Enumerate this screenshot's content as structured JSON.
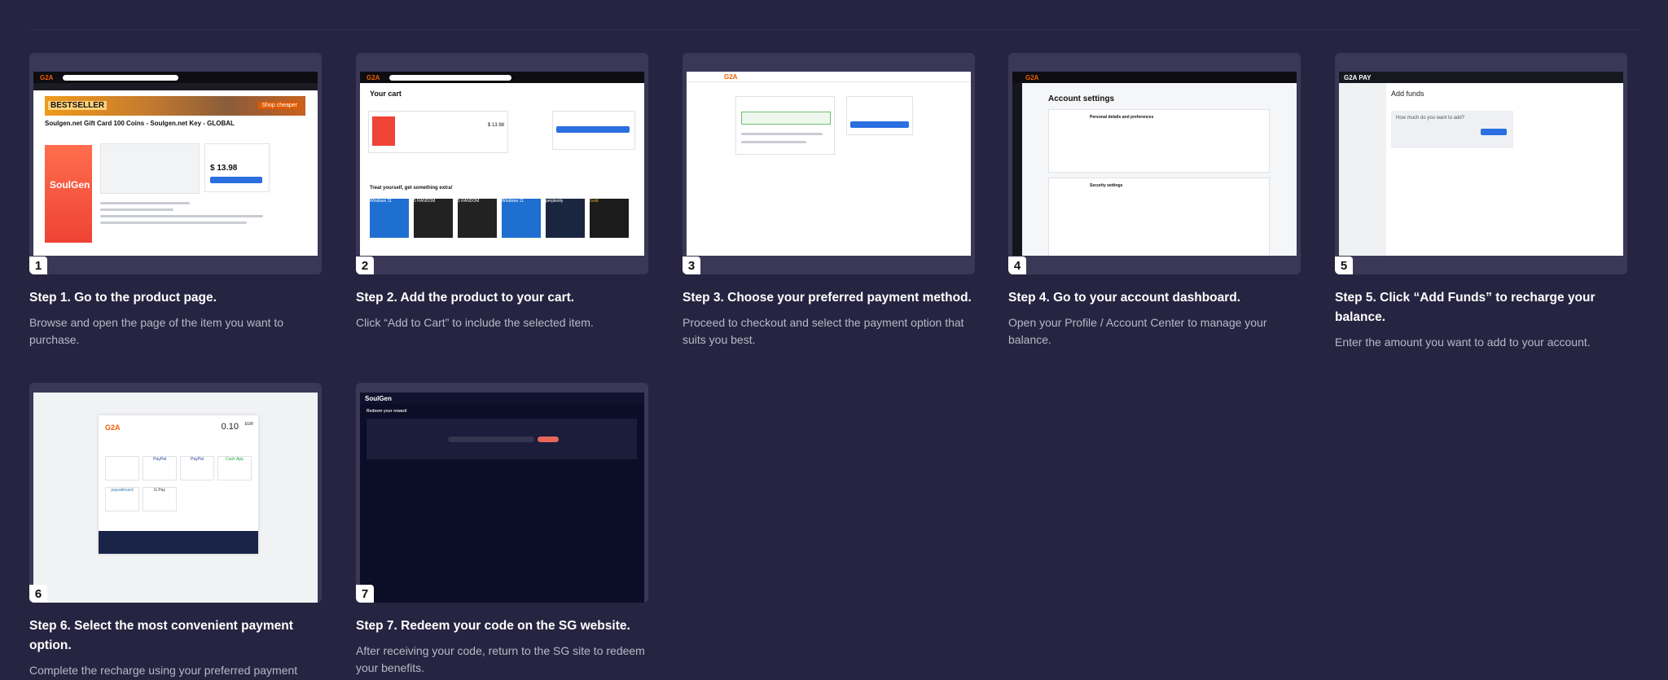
{
  "steps": [
    {
      "number": "1",
      "title": "Step 1. Go to the product page.",
      "desc": "Browse and open the page of the item you want to purchase.",
      "shot": {
        "logo": "G2A",
        "banner": "BESTSELLER",
        "banner_btn": "Shop cheaper",
        "product_title": "Soulgen.net Gift Card 100 Coins - Soulgen.net Key - GLOBAL",
        "product_brand": "SoulGen",
        "price": "$ 13.98"
      }
    },
    {
      "number": "2",
      "title": "Step 2. Add the product to your cart.",
      "desc": "Click “Add to Cart” to include the selected item.",
      "shot": {
        "logo": "G2A",
        "heading": "Your cart",
        "price": "$ 13.98",
        "extras_heading": "Treat yourself, get something extra!",
        "tile_labels": [
          "Windows 11",
          "5 RANDOM",
          "5 RANDOM",
          "Windows 11",
          "perplexity",
          "Gold"
        ]
      }
    },
    {
      "number": "3",
      "title": "Step 3. Choose your preferred payment method.",
      "desc": "Proceed to checkout and select the payment option that suits you best.",
      "shot": {
        "logo": "G2A"
      }
    },
    {
      "number": "4",
      "title": "Step 4. Go to your account dashboard.",
      "desc": "Open your Profile / Account Center to manage your balance.",
      "shot": {
        "logo": "G2A",
        "heading": "Account settings",
        "section1": "Personal details and preferences",
        "section2": "Security settings"
      }
    },
    {
      "number": "5",
      "title": "Step 5. Click “Add Funds” to recharge your balance.",
      "desc": "Enter the amount you want to add to your account.",
      "shot": {
        "logo": "G2A PAY",
        "heading": "Add funds",
        "question": "How much do you want to add?"
      }
    },
    {
      "number": "6",
      "title": "Step 6. Select the most convenient payment option.",
      "desc": "Complete the recharge using your preferred payment",
      "shot": {
        "logo": "G2A",
        "amount": "0.10",
        "currency": "EUR",
        "methods": [
          "",
          "PayPal",
          "PayPal",
          "Cash App",
          "paysafecard",
          "G Pay"
        ]
      }
    },
    {
      "number": "7",
      "title": "Step 7. Redeem your code on the SG website.",
      "desc": "After receiving your code, return to the SG site to redeem your benefits.",
      "shot": {
        "logo": "SoulGen",
        "heading": "Redeem your reward"
      }
    }
  ],
  "colors": {
    "background": "#262440",
    "card_frame": "#3a3856",
    "title": "#ffffff",
    "desc": "#b9b8c9",
    "g2a_orange": "#f05f00",
    "g2a_blue": "#2b6fe0"
  }
}
